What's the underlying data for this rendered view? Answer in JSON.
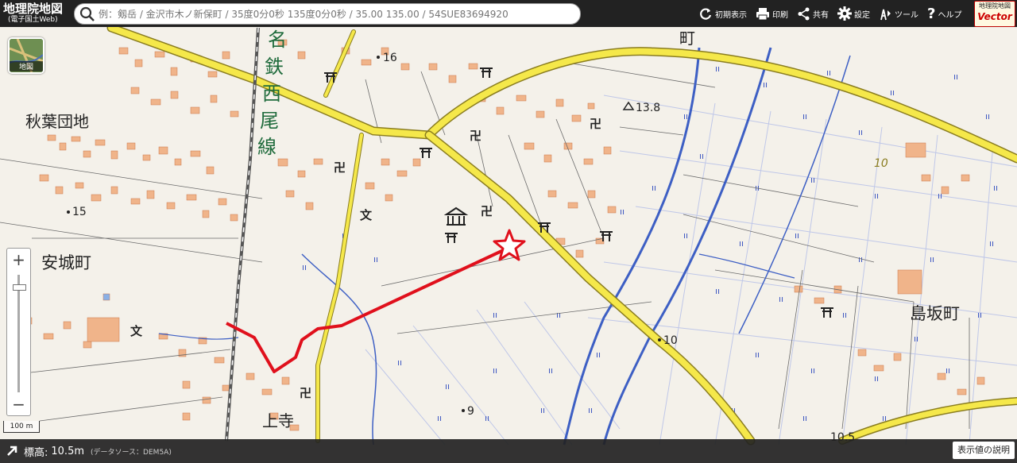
{
  "app": {
    "title": "地理院地図",
    "subtitle": "(電子国土Web)"
  },
  "search": {
    "placeholder": "例：剱岳 / 金沢市木ノ新保町 / 35度0分0秒 135度0分0秒 / 35.00 135.00 / 54SUE83694920"
  },
  "toolbar": {
    "items": [
      {
        "label": "初期表示",
        "icon": "reset-icon"
      },
      {
        "label": "印刷",
        "icon": "printer-icon"
      },
      {
        "label": "共有",
        "icon": "share-icon"
      },
      {
        "label": "設定",
        "icon": "gear-icon"
      },
      {
        "label": "ツール",
        "icon": "tool-icon"
      },
      {
        "label": "ヘルプ",
        "icon": "help-icon"
      }
    ]
  },
  "brand": {
    "top": "地理院地図",
    "bottom": "Vector"
  },
  "layer_button": {
    "label": "地図"
  },
  "zoom": {
    "in": "+",
    "out": "−"
  },
  "scale": {
    "label": "100 m"
  },
  "footer": {
    "elevation_label": "標高:",
    "elevation_value": "10.5m",
    "data_source": "(データソース：DEM5A)",
    "explain_button": "表示値の説明"
  },
  "map": {
    "colors": {
      "background": "#f4f1ea",
      "building": "#f0b48a",
      "road_major": "#f5e84a",
      "road_minor": "#ffffff",
      "water": "#3d5fc4",
      "route": "#e0101c",
      "rail": "#555555",
      "text": "#222222",
      "rail_text": "#1f6b3c"
    },
    "place_labels": [
      "秋葉団地",
      "安城町",
      "島坂町",
      "上寺",
      "町"
    ],
    "rail_label": [
      "名",
      "鉄",
      "西",
      "尾",
      "線"
    ],
    "spot_heights": [
      "16",
      "15",
      "13.8",
      "10",
      "9",
      "10.5"
    ],
    "road_number": "10"
  }
}
